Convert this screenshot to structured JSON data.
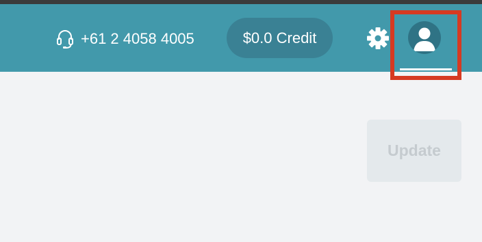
{
  "header": {
    "phone_number": "+61 2 4058 4005",
    "credit_label": "$0.0 Credit"
  },
  "icons": {
    "phone": "headset-icon",
    "settings": "gear-icon",
    "profile": "user-avatar-icon"
  },
  "main": {
    "update_label": "Update"
  },
  "colors": {
    "header_bg": "#4299ab",
    "credit_pill_bg": "#3a8194",
    "highlight_border": "#d63a22",
    "page_bg": "#f2f3f5"
  }
}
